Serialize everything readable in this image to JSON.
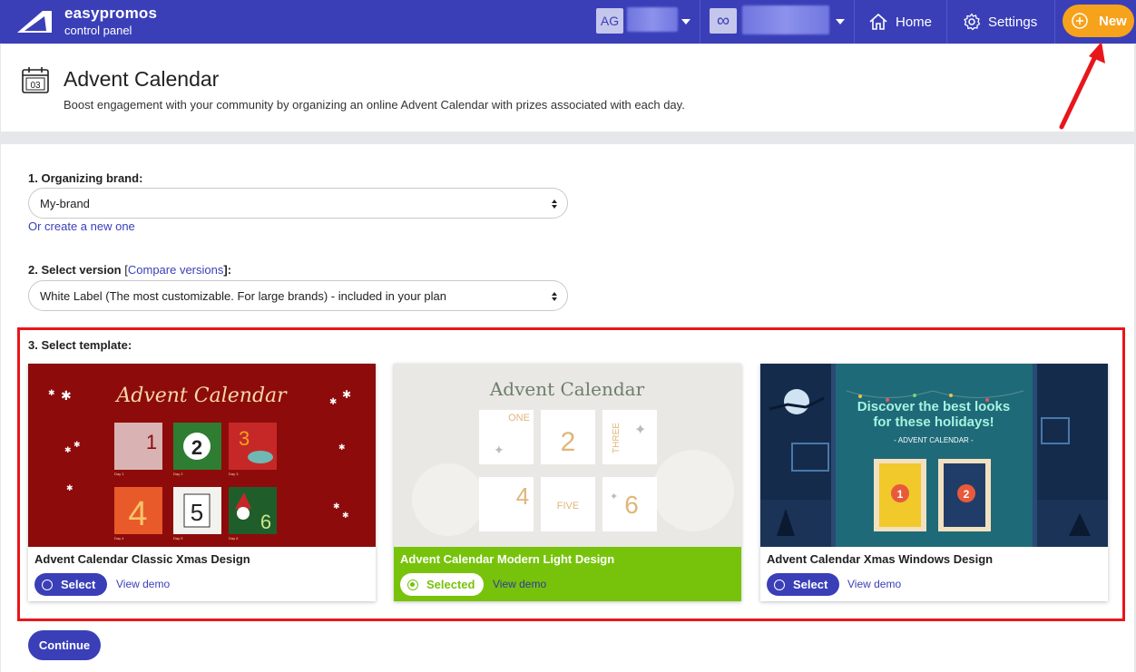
{
  "nav": {
    "brand_name": "easypromos",
    "brand_sub": "control panel",
    "account_initials": "AG",
    "account_symbol": "∞",
    "home_label": "Home",
    "settings_label": "Settings",
    "new_label": "New"
  },
  "header": {
    "calendar_day": "03",
    "title": "Advent Calendar",
    "description": "Boost engagement with your community by organizing an online Advent Calendar with prizes associated with each day."
  },
  "form": {
    "brand_label": "1. Organizing brand:",
    "brand_value": "My-brand",
    "create_link": "Or create a new one",
    "version_label_prefix": "2. Select version",
    "version_bracket_open": "[",
    "version_compare_link": "Compare versions",
    "version_bracket_close": "]:",
    "version_value": "White Label (The most customizable. For large brands) - included in your plan",
    "template_label": "3. Select template:"
  },
  "templates": [
    {
      "title": "Advent Calendar Classic Xmas Design",
      "button_label": "Select",
      "demo_label": "View demo",
      "selected": false,
      "preview": {
        "heading": "Advent Calendar",
        "numbers": [
          "1",
          "2",
          "3",
          "4",
          "5",
          "6"
        ],
        "day_labels": [
          "Day 1",
          "Day 2",
          "Day 3",
          "Day 4",
          "Day 5",
          "Day 6"
        ]
      }
    },
    {
      "title": "Advent Calendar Modern Light Design",
      "button_label": "Selected",
      "demo_label": "View demo",
      "selected": true,
      "preview": {
        "heading": "Advent Calendar",
        "numbers": [
          "ONE",
          "2",
          "THREE",
          "4",
          "FIVE",
          "6"
        ]
      }
    },
    {
      "title": "Advent Calendar Xmas Windows Design",
      "button_label": "Select",
      "demo_label": "View demo",
      "selected": false,
      "preview": {
        "heading_line1": "Discover the best looks",
        "heading_line2": "for these holidays!",
        "subheading": "- ADVENT CALENDAR -",
        "numbers": [
          "1",
          "2"
        ]
      }
    }
  ],
  "continue_label": "Continue",
  "colors": {
    "primary": "#3a3fb8",
    "accent": "#f7a21b",
    "selected_green": "#77c30b",
    "highlight_red": "#e8161b"
  }
}
